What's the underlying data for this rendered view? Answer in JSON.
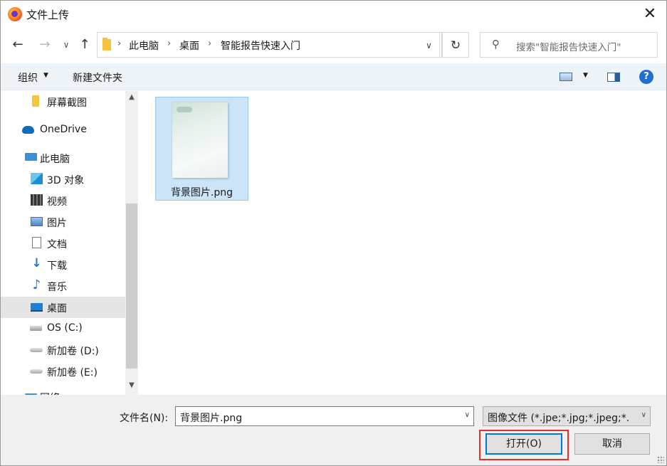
{
  "window": {
    "title": "文件上传",
    "close_glyph": "✕"
  },
  "address_bar": {
    "crumbs": [
      "此电脑",
      "桌面",
      "智能报告快速入门"
    ],
    "search_placeholder": "搜索\"智能报告快速入门\""
  },
  "command_bar": {
    "organize_label": "组织",
    "new_folder_label": "新建文件夹",
    "help_glyph": "?"
  },
  "sidebar": {
    "items": [
      {
        "label": "屏幕截图",
        "icon": "folder-icon"
      },
      {
        "label": "OneDrive",
        "icon": "onedrive-icon"
      },
      {
        "label": "此电脑",
        "icon": "this-pc-icon"
      },
      {
        "label": "3D 对象",
        "icon": "3d-objects-icon"
      },
      {
        "label": "视频",
        "icon": "video-icon"
      },
      {
        "label": "图片",
        "icon": "pictures-icon"
      },
      {
        "label": "文档",
        "icon": "documents-icon"
      },
      {
        "label": "下载",
        "icon": "download-icon"
      },
      {
        "label": "音乐",
        "icon": "music-icon"
      },
      {
        "label": "桌面",
        "icon": "desktop-icon",
        "selected": true
      },
      {
        "label": "OS (C:)",
        "icon": "drive-c-icon"
      },
      {
        "label": "新加卷 (D:)",
        "icon": "drive-icon"
      },
      {
        "label": "新加卷 (E:)",
        "icon": "drive-icon"
      },
      {
        "label": "网络",
        "icon": "network-icon"
      }
    ]
  },
  "files": [
    {
      "name": "背景图片.png",
      "selected": true
    }
  ],
  "footer": {
    "filename_label": "文件名(N):",
    "filename_value": "背景图片.png",
    "filetype_value": "图像文件 (*.jpe;*.jpg;*.jpeg;*.gif;*.png)",
    "open_label": "打开(O)",
    "cancel_label": "取消"
  },
  "colors": {
    "accent": "#0078d7",
    "selection": "#cce4f7",
    "highlight": "#e0322a"
  }
}
